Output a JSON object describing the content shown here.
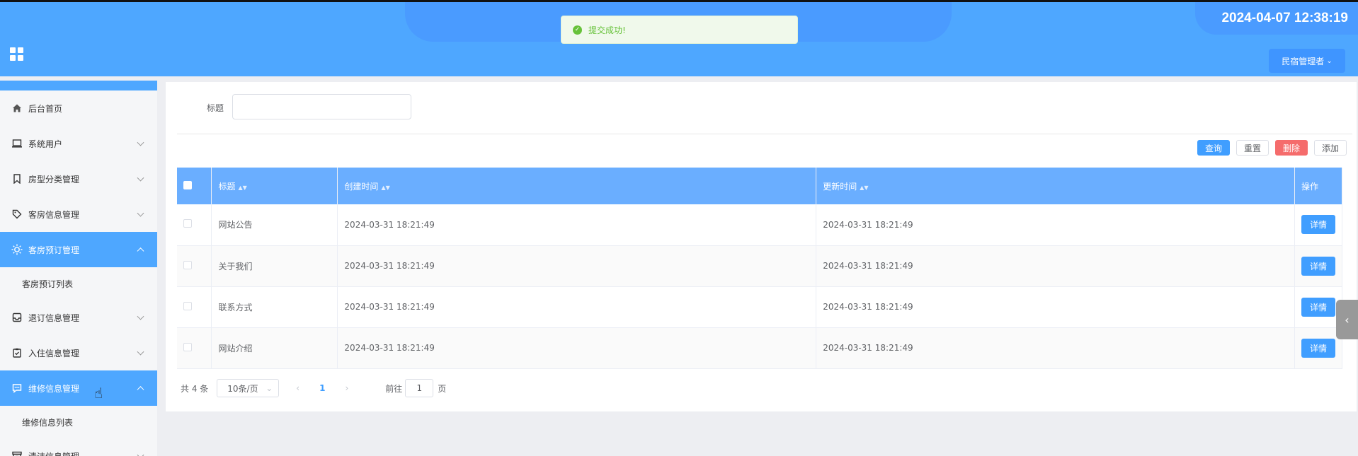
{
  "header": {
    "clock": "2024-04-07 12:38:19",
    "user_label": "民宿管理者"
  },
  "toast": {
    "message": "提交成功!"
  },
  "sidebar": {
    "items": [
      {
        "label": "后台首页",
        "icon": "home-icon"
      },
      {
        "label": "系统用户",
        "icon": "laptop-icon"
      },
      {
        "label": "房型分类管理",
        "icon": "bookmark-icon"
      },
      {
        "label": "客房信息管理",
        "icon": "tag-icon"
      },
      {
        "label": "客房预订管理",
        "icon": "sun-icon"
      },
      {
        "label": "客房预订列表"
      },
      {
        "label": "退订信息管理",
        "icon": "inbox-icon"
      },
      {
        "label": "入住信息管理",
        "icon": "clipboard-icon"
      },
      {
        "label": "维修信息管理",
        "icon": "message-icon"
      },
      {
        "label": "维修信息列表"
      },
      {
        "label": "清洁信息管理",
        "icon": "box-icon"
      }
    ]
  },
  "search": {
    "label": "标题",
    "value": ""
  },
  "buttons": {
    "query": "查询",
    "reset": "重置",
    "delete": "删除",
    "add": "添加"
  },
  "table": {
    "headers": [
      "标题",
      "创建时间",
      "更新时间",
      "操作"
    ],
    "detail_label": "详情",
    "rows": [
      {
        "title": "网站公告",
        "created": "2024-03-31 18:21:49",
        "updated": "2024-03-31 18:21:49"
      },
      {
        "title": "关于我们",
        "created": "2024-03-31 18:21:49",
        "updated": "2024-03-31 18:21:49"
      },
      {
        "title": "联系方式",
        "created": "2024-03-31 18:21:49",
        "updated": "2024-03-31 18:21:49"
      },
      {
        "title": "网站介绍",
        "created": "2024-03-31 18:21:49",
        "updated": "2024-03-31 18:21:49"
      }
    ]
  },
  "pager": {
    "total": "共 4 条",
    "page_size": "10条/页",
    "current_page": "1",
    "goto_label": "前往",
    "goto_value": "1",
    "page_suffix": "页"
  },
  "colors": {
    "primary": "#409eff",
    "header": "#4ea7ff",
    "danger": "#f56c6c",
    "success": "#67c23a"
  }
}
